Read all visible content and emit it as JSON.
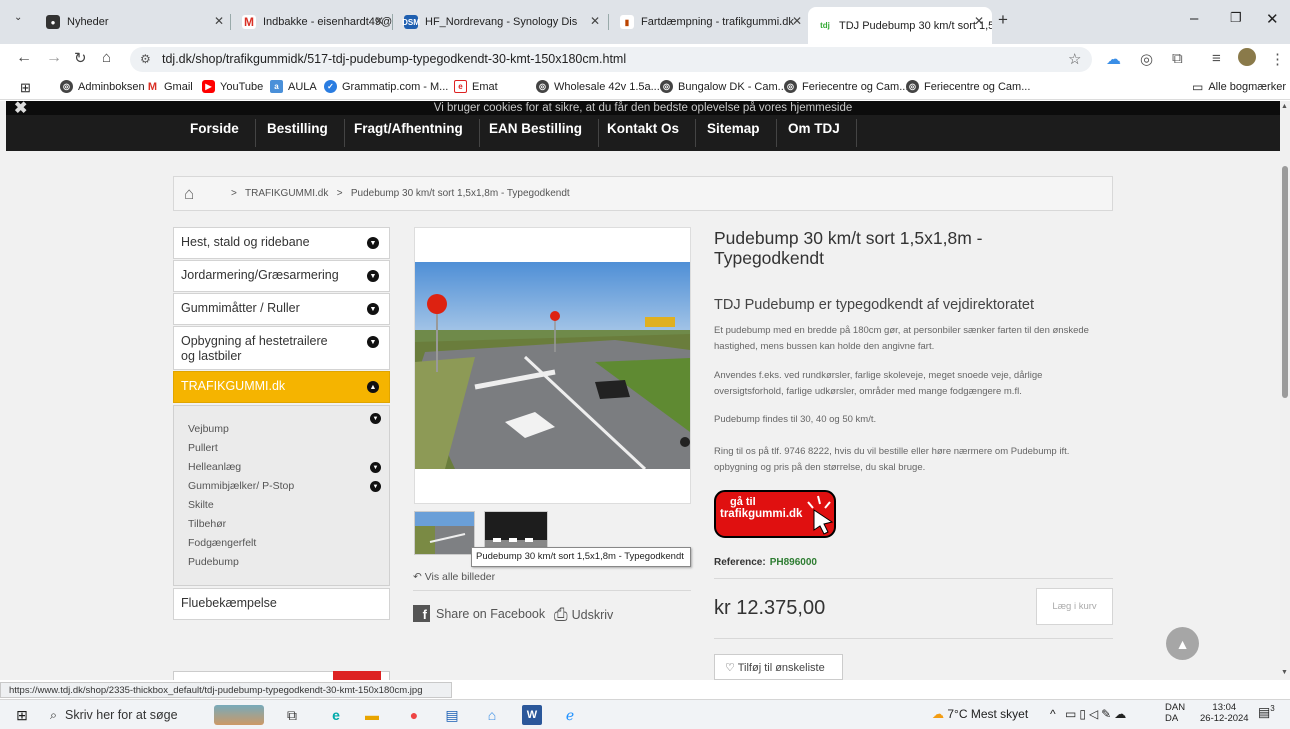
{
  "browser": {
    "tabs": [
      {
        "title": "Nyheder",
        "active": false
      },
      {
        "title": "Indbakke - eisenhardt49@gma",
        "active": false
      },
      {
        "title": "HF_Nordrevang - Synology Dis",
        "active": false
      },
      {
        "title": "Fartdæmpning - trafikgummi.dk",
        "active": false
      },
      {
        "title": "TDJ Pudebump 30 km/t sort 1,5",
        "active": true
      }
    ],
    "new_tab": "+",
    "url": "tdj.dk/shop/trafikgummidk/517-tdj-pudebump-typegodkendt-30-kmt-150x180cm.html",
    "bookmarks": [
      "Adminboksen",
      "Gmail",
      "YouTube",
      "AULA",
      "Grammatip.com - M...",
      "Emat",
      "Wholesale 42v 1.5a...",
      "Bungalow DK - Cam...",
      "Feriecentre og Cam...",
      "Feriecentre og Cam..."
    ],
    "all_bookmarks": "Alle bogmærker",
    "status_url": "https://www.tdj.dk/shop/2335-thickbox_default/tdj-pudebump-typegodkendt-30-kmt-150x180cm.jpg"
  },
  "site": {
    "cookie_notice": "Vi bruger cookies for at sikre, at du får den bedste oplevelse på vores hjemmeside",
    "menu": [
      "Forside",
      "Bestilling",
      "Fragt/Afhentning",
      "EAN Bestilling",
      "Kontakt Os",
      "Sitemap",
      "Om TDJ"
    ],
    "breadcrumb": {
      "sep": ">",
      "category": "TRAFIKGUMMI.dk",
      "current": "Pudebump 30 km/t sort 1,5x1,8m - Typegodkendt"
    },
    "categories": [
      "Hest, stald og ridebane",
      "Jordarmering/Græsarmering",
      "Gummimåtter / Ruller",
      "Opbygning af hestetrailere og lastbiler",
      "TRAFIKGUMMI.dk",
      "Fluebekæmpelse"
    ],
    "subcategories": [
      "Vejbump",
      "Pullert",
      "Helleanlæg",
      "Gummibjælker/ P-Stop",
      "Skilte",
      "Tilbehør",
      "Fodgængerfelt",
      "Pudebump"
    ],
    "image_tooltip": "Pudebump 30 km/t sort 1,5x1,8m - Typegodkendt",
    "view_all_images": "Vis alle billeder",
    "share_facebook": "Share on Facebook",
    "print": "Udskriv",
    "product": {
      "title": "Pudebump 30 km/t sort 1,5x1,8m - Typegodkendt",
      "subtitle": "TDJ Pudebump er typegodkendt af vejdirektoratet",
      "paragraphs": [
        "Et pudebump med en bredde på 180cm gør, at personbiler sænker farten til den ønskede hastighed, mens bussen kan holde den angivne fart.",
        "Anvendes f.eks. ved rundkørsler, farlige skoleveje, meget snoede veje, dårlige oversigtsforhold, farlige udkørsler, områder med mange fodgængere m.fl.",
        "Pudebump findes til 30, 40 og 50 km/t.",
        "Ring til os på tlf. 9746 8222, hvis du vil bestille eller høre nærmere om Pudebump ift. opbygning og pris på den størrelse, du skal bruge."
      ],
      "promo_line1": "gå til",
      "promo_line2": "trafikgummi.dk",
      "reference_label": "Reference:",
      "reference": "PH896000",
      "price": "kr 12.375,00",
      "add_to_cart": "Læg i kurv",
      "wishlist": "Tilføj til ønskeliste"
    }
  },
  "taskbar": {
    "search_placeholder": "Skriv her for at søge",
    "weather": "7°C  Mest skyet",
    "lang": "DAN",
    "lang2": "DA",
    "time": "13:04",
    "date": "26-12-2024",
    "notifications": "3"
  },
  "colors": {
    "accent": "#f5b400",
    "nav": "#1c1c1c",
    "promo": "#e01010",
    "reference": "#2e7d32"
  }
}
